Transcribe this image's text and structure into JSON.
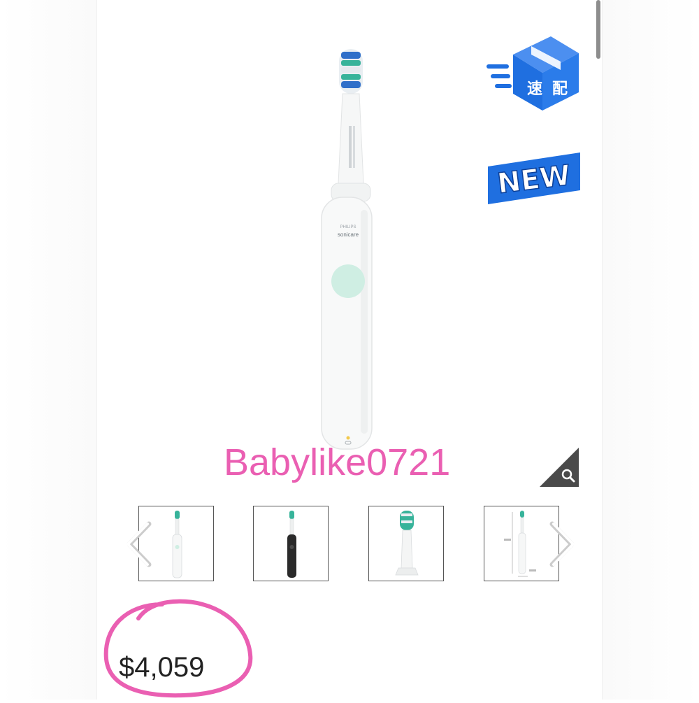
{
  "product": {
    "brand_text": "PHILIPS",
    "model_text": "sonicare",
    "watermark": "Babylike0721",
    "price": "$4,059"
  },
  "badges": {
    "fast_delivery_chars": [
      "速",
      "配"
    ],
    "new_label": "NEW"
  },
  "gallery": {
    "thumbnails": [
      "white-toothbrush",
      "black-toothbrush",
      "brush-head",
      "dimensions-diagram"
    ],
    "prev_icon": "chevron-left-icon",
    "next_icon": "chevron-right-icon",
    "zoom_icon": "magnifier-icon"
  },
  "colors": {
    "accent_pink": "#ea5fb2",
    "badge_blue": "#1f6fe0",
    "button_mint": "#cfeee3"
  }
}
